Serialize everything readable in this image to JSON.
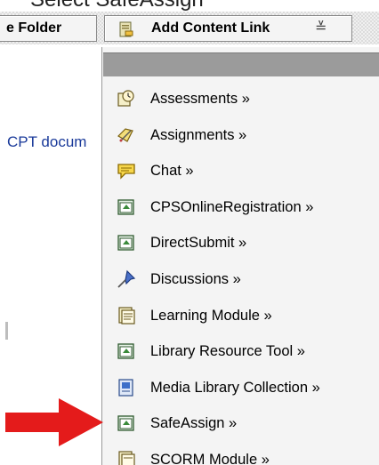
{
  "top_fragment": "Select SafeAssign",
  "toolbar": {
    "folder_button_label": "e Folder",
    "add_content_link_label": "Add Content Link",
    "sort_glyph": "≚"
  },
  "content": {
    "partial_link": "CPT docum"
  },
  "menu": {
    "items": [
      {
        "label": "Assessments »",
        "icon": "assessment-icon"
      },
      {
        "label": "Assignments »",
        "icon": "assignment-icon"
      },
      {
        "label": "Chat »",
        "icon": "chat-icon"
      },
      {
        "label": "CPSOnlineRegistration »",
        "icon": "tool-icon"
      },
      {
        "label": "DirectSubmit »",
        "icon": "tool-icon"
      },
      {
        "label": "Discussions »",
        "icon": "discussion-pin-icon"
      },
      {
        "label": "Learning Module »",
        "icon": "learning-module-icon"
      },
      {
        "label": "Library Resource Tool »",
        "icon": "tool-icon"
      },
      {
        "label": "Media Library Collection »",
        "icon": "media-library-icon"
      },
      {
        "label": "SafeAssign »",
        "icon": "tool-icon"
      },
      {
        "label": "SCORM Module »",
        "icon": "scorm-icon"
      }
    ]
  },
  "colors": {
    "annotation_arrow": "#e41b1b",
    "menu_header": "#9b9b9b",
    "link": "#1a3a9a"
  }
}
